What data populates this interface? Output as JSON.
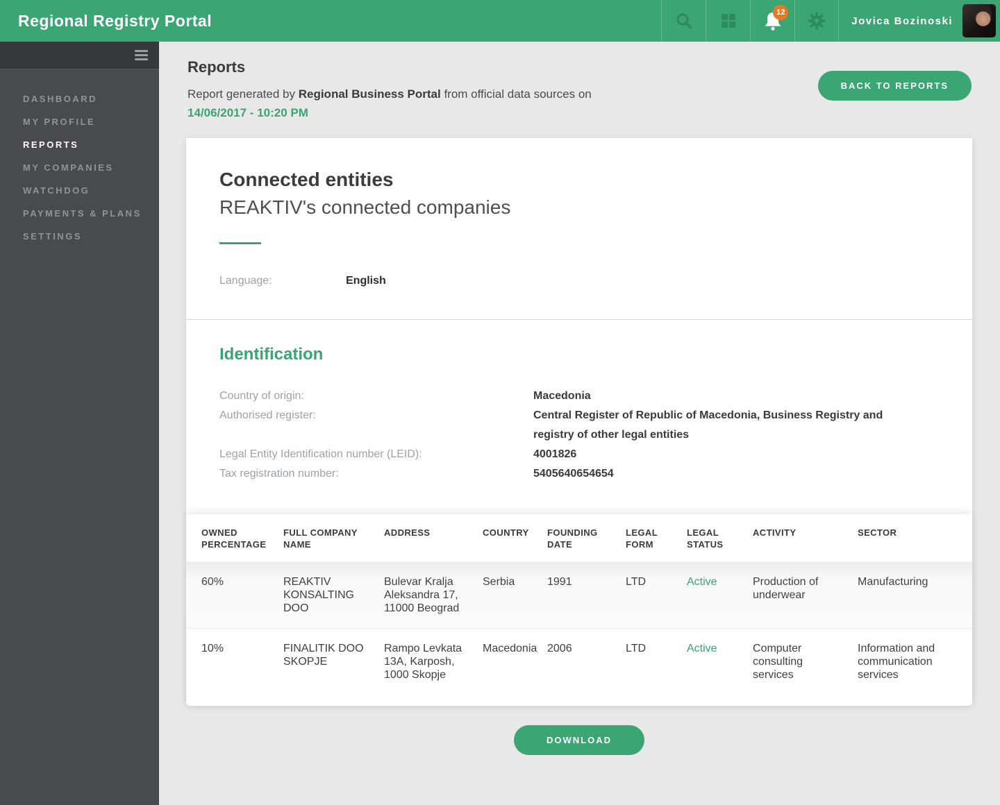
{
  "colors": {
    "accent_green": "#3ba573",
    "accent_text_green": "#3aa474",
    "badge_orange": "#e87a23",
    "sidebar_bg": "#474b4e",
    "status_active": "#3aa474"
  },
  "header": {
    "title": "Regional Registry Portal",
    "notification_count": "12",
    "user_name": "Jovica Bozinoski",
    "icons": [
      "search-icon",
      "apps-grid-icon",
      "notifications-bell-icon",
      "settings-gear-icon"
    ]
  },
  "sidebar": {
    "items": [
      {
        "label": "DASHBOARD",
        "active": false
      },
      {
        "label": "MY PROFILE",
        "active": false
      },
      {
        "label": "REPORTS",
        "active": true
      },
      {
        "label": "MY COMPANIES",
        "active": false
      },
      {
        "label": "WATCHDOG",
        "active": false
      },
      {
        "label": "PAYMENTS & PLANS",
        "active": false
      },
      {
        "label": "SETTINGS",
        "active": false
      }
    ]
  },
  "page": {
    "title": "Reports",
    "subtitle_prefix": "Report generated by ",
    "subtitle_brand": "Regional Business Portal",
    "subtitle_middle": " from official data sources on ",
    "subtitle_date": "14/06/2017 - 10:20 PM",
    "back_button_label": "BACK TO REPORTS"
  },
  "report": {
    "section_title": "Connected entities",
    "section_subtitle": "REAKTIV's connected companies",
    "language_label": "Language:",
    "language_value": "English",
    "identification": {
      "title": "Identification",
      "fields": [
        {
          "label": "Country of origin:",
          "value": "Macedonia"
        },
        {
          "label": "Authorised register:",
          "value": "Central Register of Republic of Macedonia, Business Registry and registry of other legal entities"
        },
        {
          "label": "Legal Entity Identification number (LEID):",
          "value": "4001826"
        },
        {
          "label": "Tax registration number:",
          "value": "5405640654654"
        }
      ]
    },
    "table": {
      "columns": [
        "OWNED PERCENTAGE",
        "FULL COMPANY NAME",
        "ADDRESS",
        "COUNTRY",
        "FOUNDING DATE",
        "LEGAL FORM",
        "LEGAL STATUS",
        "ACTIVITY",
        "SECTOR"
      ],
      "rows": [
        {
          "owned_percentage": "60%",
          "full_company_name": "REAKTIV KONSALTING DOO",
          "address": "Bulevar Kralja Aleksandra 17, 11000 Beograd",
          "country": "Serbia",
          "founding_date": "1991",
          "legal_form": "LTD",
          "legal_status": "Active",
          "activity": "Production of underwear",
          "sector": "Manufacturing"
        },
        {
          "owned_percentage": "10%",
          "full_company_name": "FINALITIK DOO SKOPJE",
          "address": "Rampo Levkata 13A, Karposh, 1000 Skopje",
          "country": "Macedonia",
          "founding_date": "2006",
          "legal_form": "LTD",
          "legal_status": "Active",
          "activity": "Computer consulting services",
          "sector": "Information and communication services"
        }
      ]
    },
    "download_button_label": "DOWNLOAD"
  }
}
